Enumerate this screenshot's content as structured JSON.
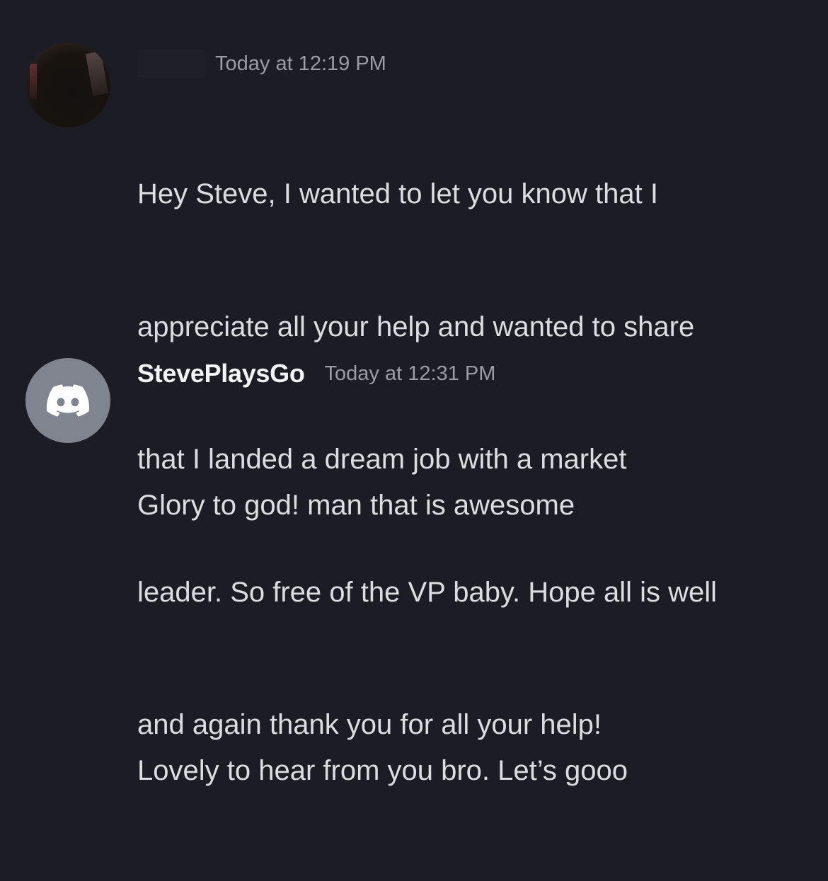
{
  "messages": [
    {
      "author": "",
      "timestamp": "Today at 12:19 PM",
      "lines": [
        "Hey Steve, I wanted to let you know that I",
        "appreciate all your help and wanted to share",
        "that I landed a dream job with a market",
        "leader. So free of the VP baby. Hope all is well",
        "and again thank you for all your help!"
      ]
    },
    {
      "author": "StevePlaysGo",
      "timestamp": "Today at 12:31 PM",
      "lines": [
        "Glory to god! man that is awesome",
        "",
        "Lovely to hear from you bro. Let’s gooo"
      ]
    }
  ],
  "colors": {
    "background": "#1c1d24",
    "text": "#dcdde1",
    "username": "#f2f3f5",
    "timestamp": "#9a9ca3",
    "discord_avatar": "#80848e"
  },
  "icons": {
    "default_avatar": "discord-logo-icon"
  }
}
